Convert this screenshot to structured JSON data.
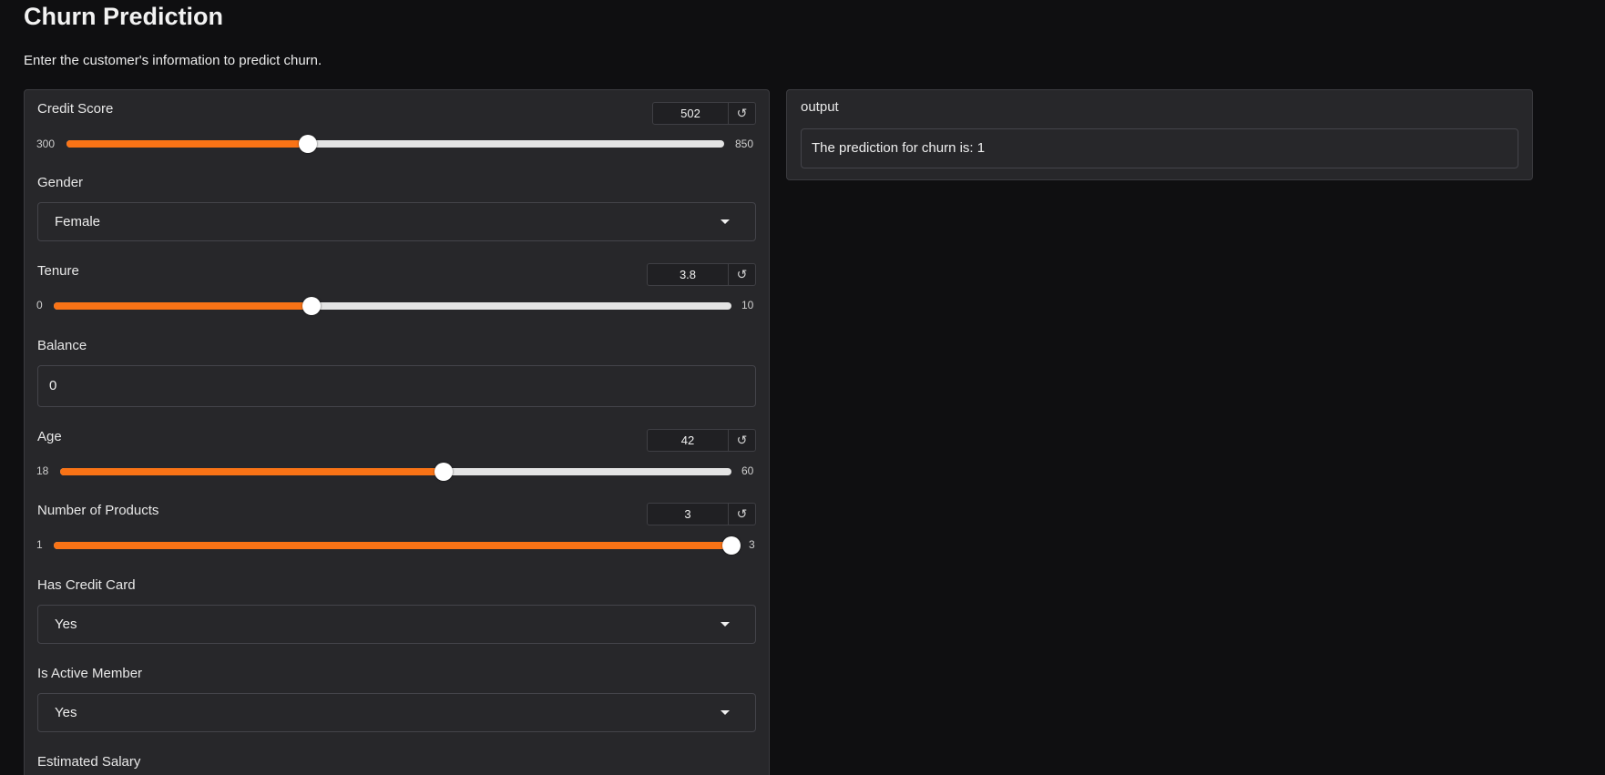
{
  "page": {
    "title": "Churn Prediction",
    "description": "Enter the customer's information to predict churn."
  },
  "inputs": {
    "credit_score": {
      "label": "Credit Score",
      "value": "502",
      "min": "300",
      "max": "850",
      "fraction": 0.367
    },
    "gender": {
      "label": "Gender",
      "value": "Female"
    },
    "tenure": {
      "label": "Tenure",
      "value": "3.8",
      "min": "0",
      "max": "10",
      "fraction": 0.38
    },
    "balance": {
      "label": "Balance",
      "value": "0"
    },
    "age": {
      "label": "Age",
      "value": "42",
      "min": "18",
      "max": "60",
      "fraction": 0.571
    },
    "num_products": {
      "label": "Number of Products",
      "value": "3",
      "min": "1",
      "max": "3",
      "fraction": 1.0
    },
    "has_credit_card": {
      "label": "Has Credit Card",
      "value": "Yes"
    },
    "is_active_member": {
      "label": "Is Active Member",
      "value": "Yes"
    },
    "estimated_salary": {
      "label": "Estimated Salary"
    }
  },
  "output": {
    "label": "output",
    "text": "The prediction for churn is: 1"
  },
  "icons": {
    "reset": "reset-icon",
    "dropdown": "caret-down-icon"
  },
  "colors": {
    "accent": "#f97316",
    "panel": "#27272a",
    "background": "#0f0f11"
  }
}
